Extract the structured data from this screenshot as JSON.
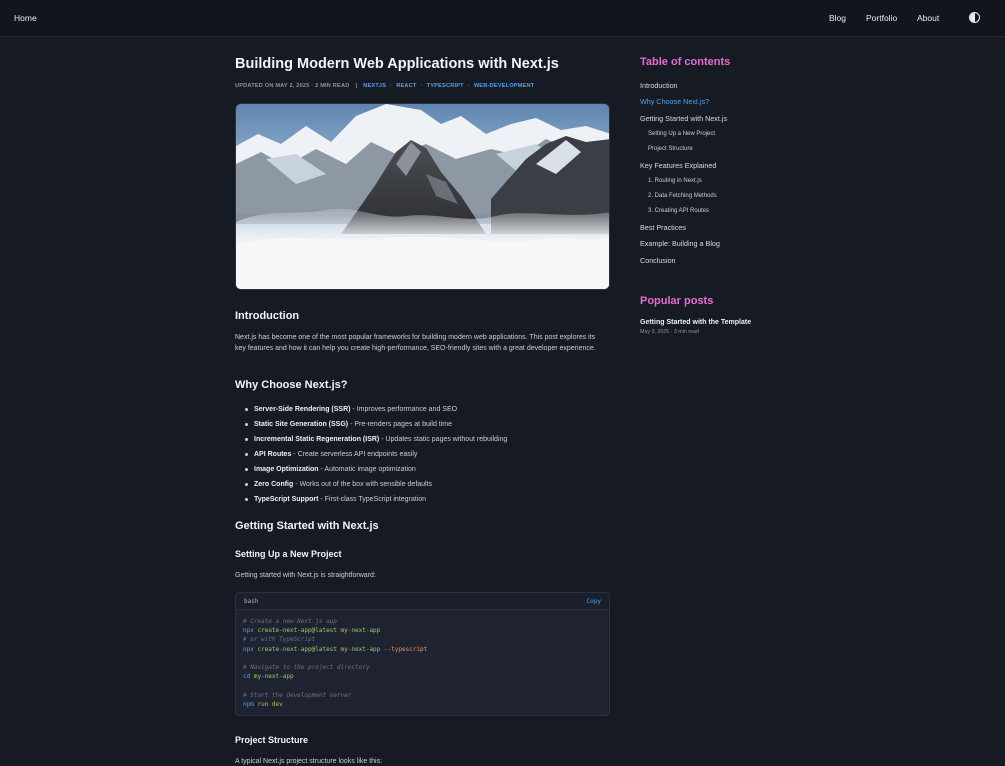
{
  "nav": {
    "home": "Home",
    "links": [
      "Blog",
      "Portfolio",
      "About"
    ],
    "theme_icon": "contrast-half-circle-icon"
  },
  "article": {
    "title": "Building Modern Web Applications with Next.js",
    "meta": {
      "updated": "UPDATED ON MAY 2, 2025 · 2 MIN READ",
      "separator": "|",
      "dot": "·",
      "tags": [
        "NEXTJS",
        "REACT",
        "TYPESCRIPT",
        "WEB-DEVELOPMENT"
      ]
    },
    "hero_image": "mountain-peaks-above-clouds",
    "intro": {
      "heading": "Introduction",
      "text": "Next.js has become one of the most popular frameworks for building modern web applications. This post explores its key features and how it can help you create high-performance, SEO-friendly sites with a great developer experience."
    },
    "why": {
      "heading": "Why Choose Next.js?",
      "features": [
        {
          "bold": "Server-Side Rendering (SSR)",
          "text": " - Improves performance and SEO"
        },
        {
          "bold": "Static Site Generation (SSG)",
          "text": " - Pre-renders pages at build time"
        },
        {
          "bold": "Incremental Static Regeneration (ISR)",
          "text": " - Updates static pages without rebuilding"
        },
        {
          "bold": "API Routes",
          "text": " - Create serverless API endpoints easily"
        },
        {
          "bold": "Image Optimization",
          "text": " - Automatic image optimization"
        },
        {
          "bold": "Zero Config",
          "text": " - Works out of the box with sensible defaults"
        },
        {
          "bold": "TypeScript Support",
          "text": " - First-class TypeScript integration"
        }
      ]
    },
    "getting_started": {
      "heading": "Getting Started with Next.js",
      "setup_heading": "Setting Up a New Project",
      "setup_text": "Getting started with Next.js is straightforward:"
    },
    "code": {
      "lang": "bash",
      "copy": "Copy",
      "lines": [
        [
          {
            "t": "# Create a new Next.js app",
            "c": "c-com"
          }
        ],
        [
          {
            "t": "npx",
            "c": "c-cmd"
          },
          {
            "t": " create-next-app@latest my-next-app",
            "c": "c-arg"
          }
        ],
        [
          {
            "t": "# or with TypeScript",
            "c": "c-com"
          }
        ],
        [
          {
            "t": "npx",
            "c": "c-cmd"
          },
          {
            "t": " create-next-app@latest my-next-app ",
            "c": "c-arg"
          },
          {
            "t": "--typescript",
            "c": "c-flag"
          }
        ],
        [],
        [
          {
            "t": "# Navigate to the project directory",
            "c": "c-com"
          }
        ],
        [
          {
            "t": "cd",
            "c": "c-cmd"
          },
          {
            "t": " my-next-app",
            "c": "c-arg"
          }
        ],
        [],
        [
          {
            "t": "# Start the development server",
            "c": "c-com"
          }
        ],
        [
          {
            "t": "npm",
            "c": "c-cmd"
          },
          {
            "t": " run dev",
            "c": "c-arg"
          }
        ]
      ]
    },
    "structure": {
      "heading": "Project Structure",
      "text": "A typical Next.js project structure looks like this:"
    }
  },
  "sidebar": {
    "toc_title": "Table of contents",
    "toc": [
      {
        "label": "Introduction",
        "level": 1,
        "active": false
      },
      {
        "label": "Why Choose Next.js?",
        "level": 1,
        "active": true
      },
      {
        "label": "Getting Started with Next.js",
        "level": 1,
        "active": false
      },
      {
        "label": "Setting Up a New Project",
        "level": 2,
        "active": false
      },
      {
        "label": "Project Structure",
        "level": 2,
        "active": false
      },
      {
        "label": "Key Features Explained",
        "level": 1,
        "active": false
      },
      {
        "label": "1. Routing in Next.js",
        "level": 2,
        "active": false
      },
      {
        "label": "2. Data Fetching Methods",
        "level": 2,
        "active": false
      },
      {
        "label": "3. Creating API Routes",
        "level": 2,
        "active": false
      },
      {
        "label": "Best Practices",
        "level": 1,
        "active": false
      },
      {
        "label": "Example: Building a Blog",
        "level": 1,
        "active": false
      },
      {
        "label": "Conclusion",
        "level": 1,
        "active": false
      }
    ],
    "popular_title": "Popular posts",
    "popular": [
      {
        "title": "Getting Started with the Template",
        "meta": "May 3, 2025 · 3 min read"
      }
    ]
  }
}
